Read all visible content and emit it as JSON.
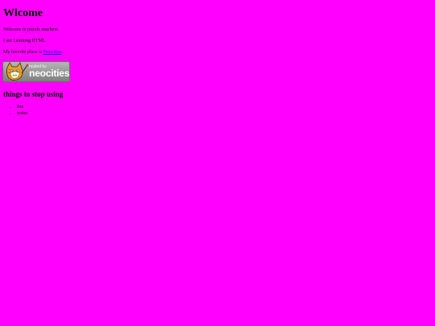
{
  "heading": "Wlcome",
  "paragraphs": {
    "welcome": "Welcome to puzzle mayhem",
    "learning": "I am Learning HTML"
  },
  "favorite": {
    "prefix": "My favorite place is ",
    "link_text": "Neocities",
    "suffix": "."
  },
  "badge": {
    "line1": "hosted by",
    "line2": "neocities",
    "icon": "neocities-cat-icon"
  },
  "subheading": "things to stop using",
  "list_items": [
    "fire",
    "water"
  ],
  "colors": {
    "background": "#ff00ff",
    "link": "#0000ee"
  }
}
